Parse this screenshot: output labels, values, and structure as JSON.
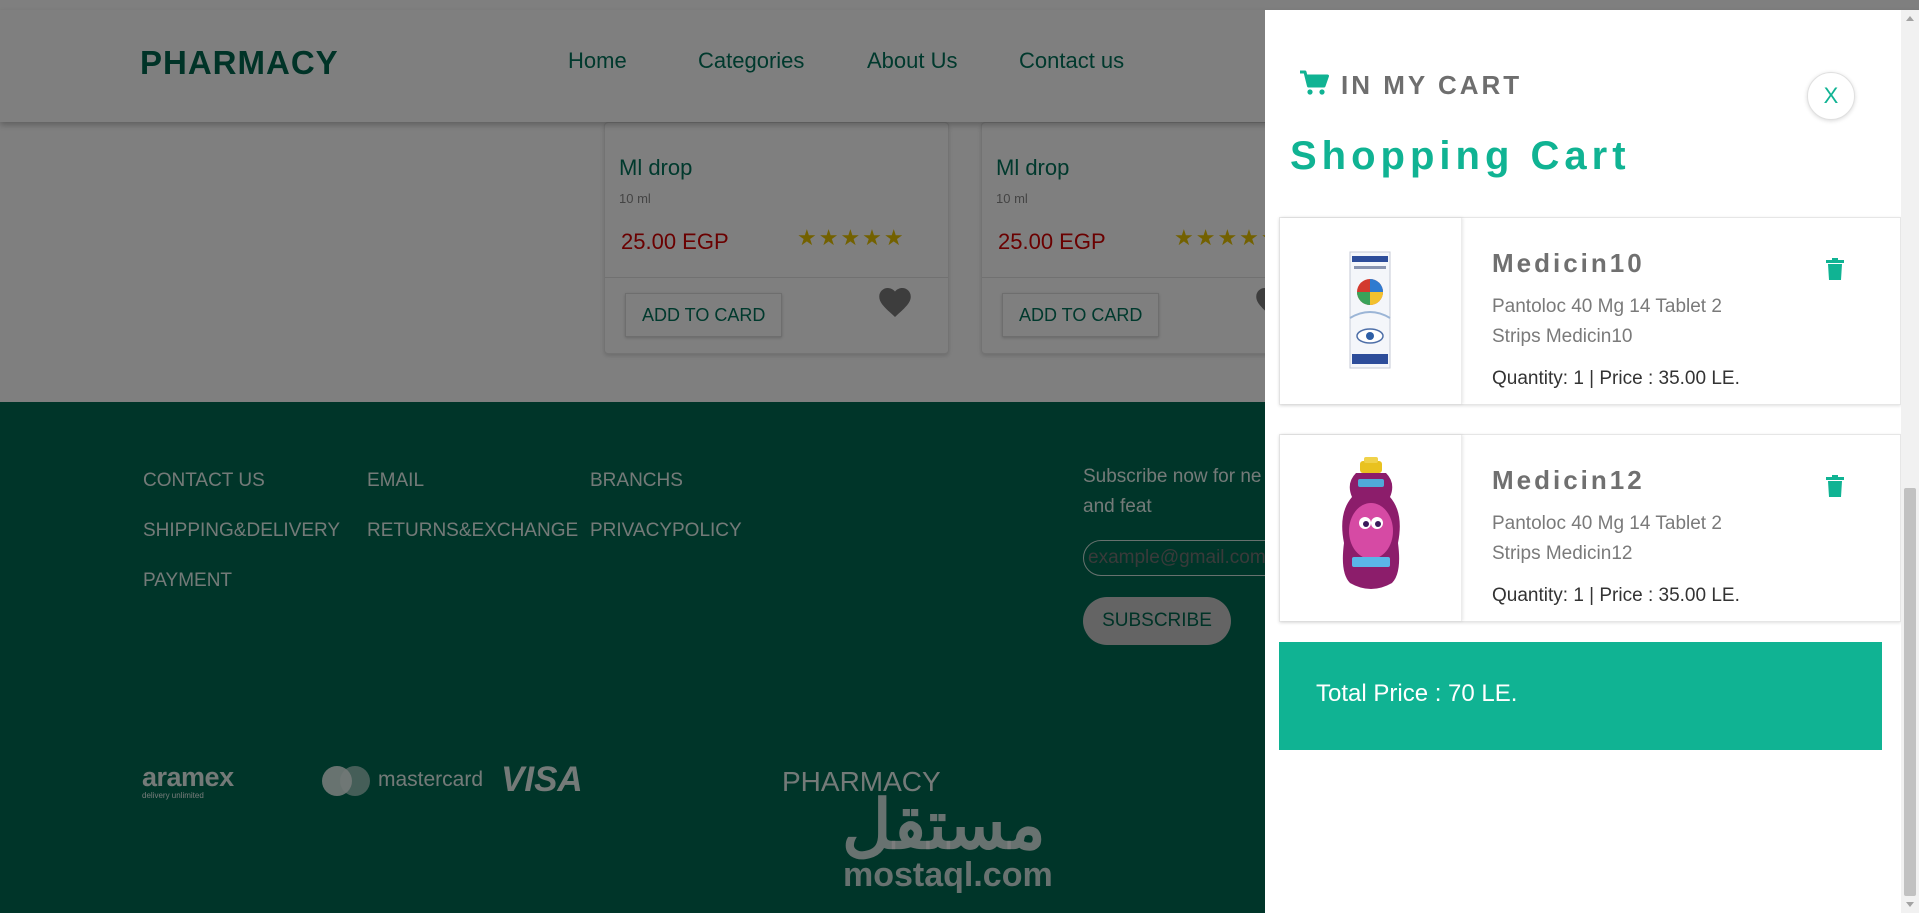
{
  "navbar": {
    "brand": "PHARMACY",
    "links": [
      "Home",
      "Categories",
      "About Us",
      "Contact us"
    ]
  },
  "products": [
    {
      "name": "Ml drop",
      "size": "10 ml",
      "price": "25.00 EGP",
      "stars": "★★★★★",
      "add_label": "ADD TO CARD"
    },
    {
      "name": "Ml drop",
      "size": "10 ml",
      "price": "25.00 EGP",
      "stars": "★★★★★",
      "add_label": "ADD TO CARD"
    }
  ],
  "footer": {
    "links": [
      "CONTACT US",
      "EMAIL",
      "BRANCHS",
      "SHIPPING&DELIVERY",
      "RETURNS&EXCHANGE",
      "PRIVACYPOLICY",
      "PAYMENT"
    ],
    "subscribe_text": "Subscribe now for ne latest offers and feat",
    "email_placeholder": "example@gmail.com",
    "subscribe_label": "SUBSCRIBE",
    "partners": {
      "aramex": "aramex",
      "aramex_tagline": "delivery unlimited",
      "mastercard": "mastercard",
      "visa": "VISA"
    },
    "brand": "PHARMACY",
    "watermark_arabic": "مستقل",
    "watermark_latin": "mostaql.com"
  },
  "cart": {
    "header_label": "IN MY CART",
    "close_label": "X",
    "title": "Shopping Cart",
    "items": [
      {
        "name": "Medicin10",
        "description": "Pantoloc 40 Mg 14 Tablet 2 Strips Medicin10",
        "quantity_price": "Quantity: 1 | Price : 35.00 LE.",
        "image": "eye-drops-box"
      },
      {
        "name": "Medicin12",
        "description": "Pantoloc 40 Mg 14 Tablet 2 Strips Medicin12",
        "quantity_price": "Quantity: 1 | Price : 35.00 LE.",
        "image": "kids-shampoo-bottle"
      }
    ],
    "total": "Total Price : 70 LE."
  },
  "colors": {
    "brand_green": "#00664f",
    "cart_accent": "#10b393",
    "price_red": "#d40000",
    "footer_bg": "#006b53"
  },
  "icons": [
    "shopping-cart-icon",
    "trash-icon",
    "heart-icon",
    "star-icon"
  ]
}
